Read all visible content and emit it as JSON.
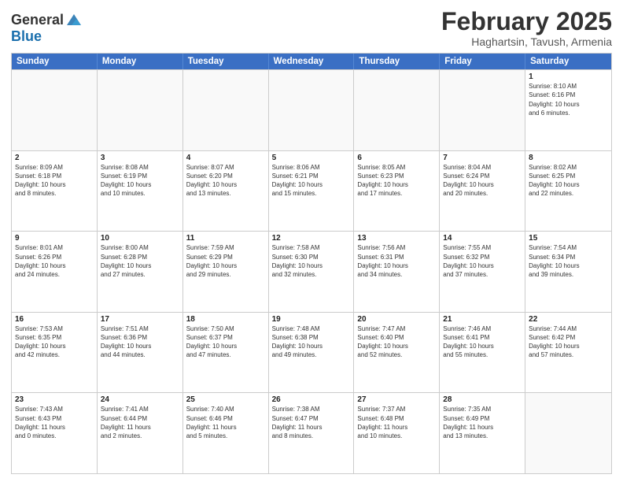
{
  "header": {
    "logo_general": "General",
    "logo_blue": "Blue",
    "month_title": "February 2025",
    "location": "Haghartsin, Tavush, Armenia"
  },
  "days_of_week": [
    "Sunday",
    "Monday",
    "Tuesday",
    "Wednesday",
    "Thursday",
    "Friday",
    "Saturday"
  ],
  "weeks": [
    [
      {
        "day": "",
        "info": "",
        "empty": true
      },
      {
        "day": "",
        "info": "",
        "empty": true
      },
      {
        "day": "",
        "info": "",
        "empty": true
      },
      {
        "day": "",
        "info": "",
        "empty": true
      },
      {
        "day": "",
        "info": "",
        "empty": true
      },
      {
        "day": "",
        "info": "",
        "empty": true
      },
      {
        "day": "1",
        "info": "Sunrise: 8:10 AM\nSunset: 6:16 PM\nDaylight: 10 hours\nand 6 minutes."
      }
    ],
    [
      {
        "day": "2",
        "info": "Sunrise: 8:09 AM\nSunset: 6:18 PM\nDaylight: 10 hours\nand 8 minutes."
      },
      {
        "day": "3",
        "info": "Sunrise: 8:08 AM\nSunset: 6:19 PM\nDaylight: 10 hours\nand 10 minutes."
      },
      {
        "day": "4",
        "info": "Sunrise: 8:07 AM\nSunset: 6:20 PM\nDaylight: 10 hours\nand 13 minutes."
      },
      {
        "day": "5",
        "info": "Sunrise: 8:06 AM\nSunset: 6:21 PM\nDaylight: 10 hours\nand 15 minutes."
      },
      {
        "day": "6",
        "info": "Sunrise: 8:05 AM\nSunset: 6:23 PM\nDaylight: 10 hours\nand 17 minutes."
      },
      {
        "day": "7",
        "info": "Sunrise: 8:04 AM\nSunset: 6:24 PM\nDaylight: 10 hours\nand 20 minutes."
      },
      {
        "day": "8",
        "info": "Sunrise: 8:02 AM\nSunset: 6:25 PM\nDaylight: 10 hours\nand 22 minutes."
      }
    ],
    [
      {
        "day": "9",
        "info": "Sunrise: 8:01 AM\nSunset: 6:26 PM\nDaylight: 10 hours\nand 24 minutes."
      },
      {
        "day": "10",
        "info": "Sunrise: 8:00 AM\nSunset: 6:28 PM\nDaylight: 10 hours\nand 27 minutes."
      },
      {
        "day": "11",
        "info": "Sunrise: 7:59 AM\nSunset: 6:29 PM\nDaylight: 10 hours\nand 29 minutes."
      },
      {
        "day": "12",
        "info": "Sunrise: 7:58 AM\nSunset: 6:30 PM\nDaylight: 10 hours\nand 32 minutes."
      },
      {
        "day": "13",
        "info": "Sunrise: 7:56 AM\nSunset: 6:31 PM\nDaylight: 10 hours\nand 34 minutes."
      },
      {
        "day": "14",
        "info": "Sunrise: 7:55 AM\nSunset: 6:32 PM\nDaylight: 10 hours\nand 37 minutes."
      },
      {
        "day": "15",
        "info": "Sunrise: 7:54 AM\nSunset: 6:34 PM\nDaylight: 10 hours\nand 39 minutes."
      }
    ],
    [
      {
        "day": "16",
        "info": "Sunrise: 7:53 AM\nSunset: 6:35 PM\nDaylight: 10 hours\nand 42 minutes."
      },
      {
        "day": "17",
        "info": "Sunrise: 7:51 AM\nSunset: 6:36 PM\nDaylight: 10 hours\nand 44 minutes."
      },
      {
        "day": "18",
        "info": "Sunrise: 7:50 AM\nSunset: 6:37 PM\nDaylight: 10 hours\nand 47 minutes."
      },
      {
        "day": "19",
        "info": "Sunrise: 7:48 AM\nSunset: 6:38 PM\nDaylight: 10 hours\nand 49 minutes."
      },
      {
        "day": "20",
        "info": "Sunrise: 7:47 AM\nSunset: 6:40 PM\nDaylight: 10 hours\nand 52 minutes."
      },
      {
        "day": "21",
        "info": "Sunrise: 7:46 AM\nSunset: 6:41 PM\nDaylight: 10 hours\nand 55 minutes."
      },
      {
        "day": "22",
        "info": "Sunrise: 7:44 AM\nSunset: 6:42 PM\nDaylight: 10 hours\nand 57 minutes."
      }
    ],
    [
      {
        "day": "23",
        "info": "Sunrise: 7:43 AM\nSunset: 6:43 PM\nDaylight: 11 hours\nand 0 minutes."
      },
      {
        "day": "24",
        "info": "Sunrise: 7:41 AM\nSunset: 6:44 PM\nDaylight: 11 hours\nand 2 minutes."
      },
      {
        "day": "25",
        "info": "Sunrise: 7:40 AM\nSunset: 6:46 PM\nDaylight: 11 hours\nand 5 minutes."
      },
      {
        "day": "26",
        "info": "Sunrise: 7:38 AM\nSunset: 6:47 PM\nDaylight: 11 hours\nand 8 minutes."
      },
      {
        "day": "27",
        "info": "Sunrise: 7:37 AM\nSunset: 6:48 PM\nDaylight: 11 hours\nand 10 minutes."
      },
      {
        "day": "28",
        "info": "Sunrise: 7:35 AM\nSunset: 6:49 PM\nDaylight: 11 hours\nand 13 minutes."
      },
      {
        "day": "",
        "info": "",
        "empty": true
      }
    ]
  ]
}
